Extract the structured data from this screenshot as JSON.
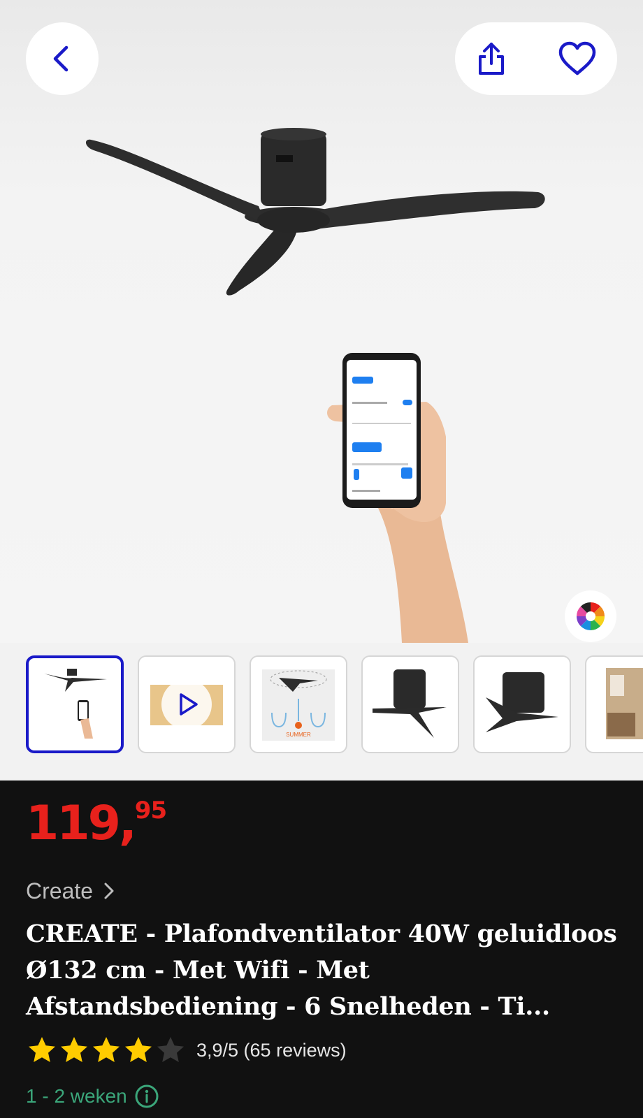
{
  "nav": {
    "back_icon": "chevron-left-icon",
    "share_icon": "share-icon",
    "favorite_icon": "heart-icon",
    "color_picker_icon": "color-wheel-icon"
  },
  "gallery": {
    "thumbnails": [
      {
        "type": "image",
        "selected": true
      },
      {
        "type": "video",
        "selected": false
      },
      {
        "type": "image",
        "label": "SUMMER",
        "selected": false
      },
      {
        "type": "image",
        "selected": false
      },
      {
        "type": "image",
        "selected": false
      },
      {
        "type": "image",
        "selected": false
      }
    ]
  },
  "product": {
    "price_whole": "119,",
    "price_cents": "95",
    "brand": "Create",
    "title": "CREATE - Plafondventilator 40W geluidloos Ø132 cm - Met Wifi - Met Afstandsbediening - 6 Snelheden - Ti...",
    "rating_value": 3.9,
    "rating_max": 5,
    "rating_text": "3,9/5 (65 reviews)",
    "delivery": "1 - 2 weken"
  },
  "colors": {
    "accent_blue": "#1a1ac8",
    "price_red": "#e8211c",
    "star_yellow": "#ffcc00",
    "delivery_green": "#3ba67a"
  }
}
